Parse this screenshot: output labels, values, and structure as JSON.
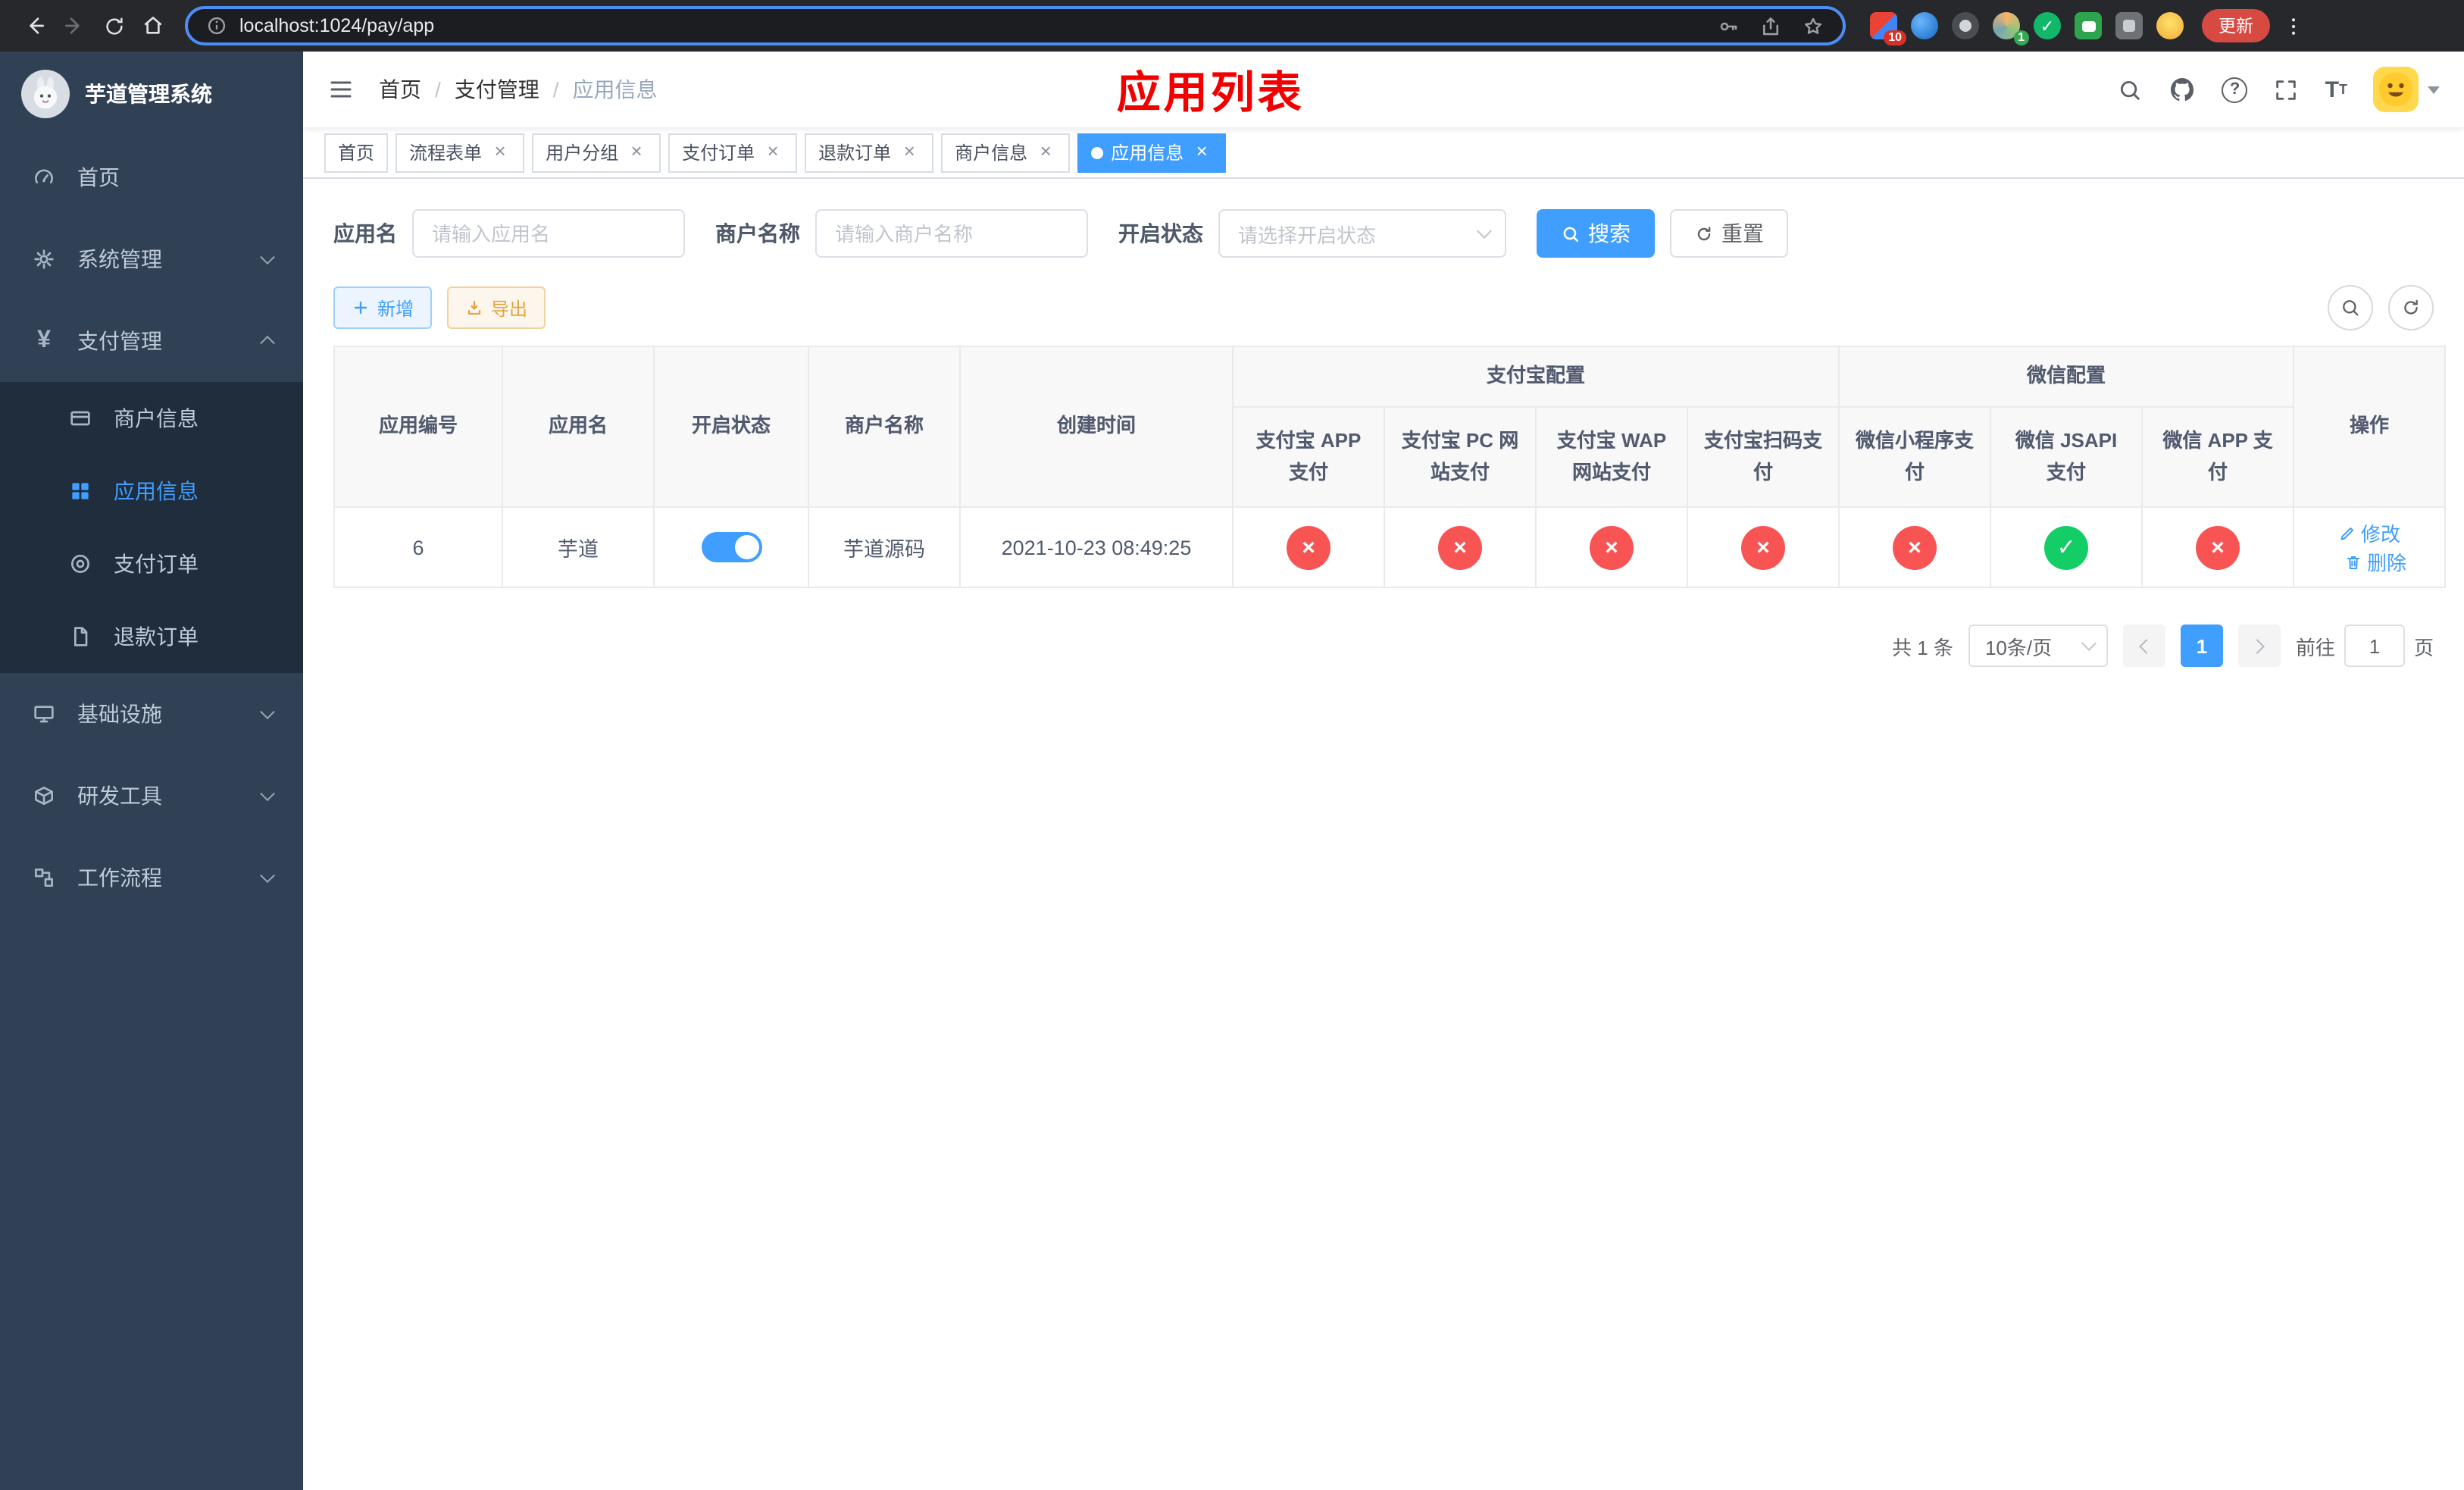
{
  "browser": {
    "url": "localhost:1024/pay/app",
    "update_label": "更新",
    "ext_badge_1": "10",
    "ext_badge_2": "1"
  },
  "sidebar": {
    "title": "芋道管理系统",
    "items": [
      {
        "label": "首页"
      },
      {
        "label": "系统管理"
      },
      {
        "label": "支付管理",
        "children": [
          {
            "label": "商户信息"
          },
          {
            "label": "应用信息"
          },
          {
            "label": "支付订单"
          },
          {
            "label": "退款订单"
          }
        ]
      },
      {
        "label": "基础设施"
      },
      {
        "label": "研发工具"
      },
      {
        "label": "工作流程"
      }
    ]
  },
  "header": {
    "breadcrumb": [
      "首页",
      "支付管理",
      "应用信息"
    ],
    "annotation": "应用列表"
  },
  "tabs": [
    {
      "label": "首页"
    },
    {
      "label": "流程表单"
    },
    {
      "label": "用户分组"
    },
    {
      "label": "支付订单"
    },
    {
      "label": "退款订单"
    },
    {
      "label": "商户信息"
    },
    {
      "label": "应用信息"
    }
  ],
  "filters": {
    "app_name_label": "应用名",
    "app_name_placeholder": "请输入应用名",
    "merchant_label": "商户名称",
    "merchant_placeholder": "请输入商户名称",
    "status_label": "开启状态",
    "status_placeholder": "请选择开启状态",
    "search_label": "搜索",
    "reset_label": "重置"
  },
  "toolbar": {
    "add_label": "新增",
    "export_label": "导出"
  },
  "table": {
    "columns": [
      "应用编号",
      "应用名",
      "开启状态",
      "商户名称",
      "创建时间"
    ],
    "group_alipay": "支付宝配置",
    "group_wechat": "微信配置",
    "alipay_cols": [
      "支付宝 APP 支付",
      "支付宝 PC 网站支付",
      "支付宝 WAP 网站支付",
      "支付宝扫码支付"
    ],
    "wechat_cols": [
      "微信小程序支付",
      "微信 JSAPI 支付",
      "微信 APP 支付"
    ],
    "op_col": "操作",
    "rows": [
      {
        "id": "6",
        "name": "芋道",
        "enabled": true,
        "merchant": "芋道源码",
        "created": "2021-10-23 08:49:25",
        "configs": [
          "no",
          "no",
          "no",
          "no",
          "no",
          "yes",
          "no"
        ],
        "edit_label": "修改",
        "delete_label": "删除"
      }
    ]
  },
  "pagination": {
    "total": "共 1 条",
    "page_size": "10条/页",
    "current_page": "1",
    "goto_prefix": "前往",
    "goto_value": "1",
    "goto_suffix": "页"
  },
  "colors": {
    "primary": "#409eff",
    "sidebar_bg": "#304156",
    "submenu_bg": "#1f2d3d",
    "status_red": "#f85454",
    "status_green": "#13ce66",
    "warning": "#e6a23c",
    "annotation_red": "#f20000"
  },
  "icon_names": [
    "back-icon",
    "forward-icon",
    "reload-icon",
    "home-icon",
    "info-icon",
    "key-icon",
    "share-icon",
    "star-icon",
    "overflow-menu-icon",
    "hamburger-icon",
    "search-icon",
    "github-icon",
    "help-icon",
    "fullscreen-icon",
    "font-size-icon",
    "caret-down-icon",
    "dashboard-icon",
    "gear-icon",
    "yen-icon",
    "credit-card-icon",
    "grid-icon",
    "target-icon",
    "file-icon",
    "monitor-icon",
    "cube-icon",
    "workflow-icon",
    "plus-icon",
    "download-icon",
    "refresh-icon",
    "edit-icon",
    "delete-icon"
  ]
}
